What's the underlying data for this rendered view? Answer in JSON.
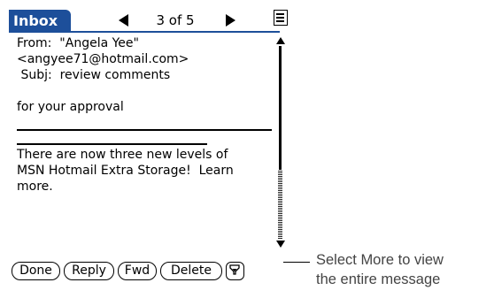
{
  "app": {
    "tab_label": "Inbox",
    "position_label": "3 of 5",
    "prev_icon": "left-arrow-icon",
    "next_icon": "right-arrow-icon",
    "menu_icon": "menu-icon",
    "accent_color": "#1d4f9a"
  },
  "message": {
    "from_line": "From:  \"Angela Yee\"",
    "email_line": "<angyee71@hotmail.com>",
    "subject_line": " Subj:  review comments",
    "body_line": "for your approval",
    "footer_lines": [
      "There are now three new levels of",
      "MSN Hotmail Extra Storage!  Learn",
      "more."
    ]
  },
  "buttons": {
    "done": "Done",
    "reply": "Reply",
    "fwd": "Fwd",
    "delete": "Delete",
    "more_icon": "more-down-icon"
  },
  "callout": {
    "line1": "Select More to view",
    "line2": "the entire message"
  }
}
